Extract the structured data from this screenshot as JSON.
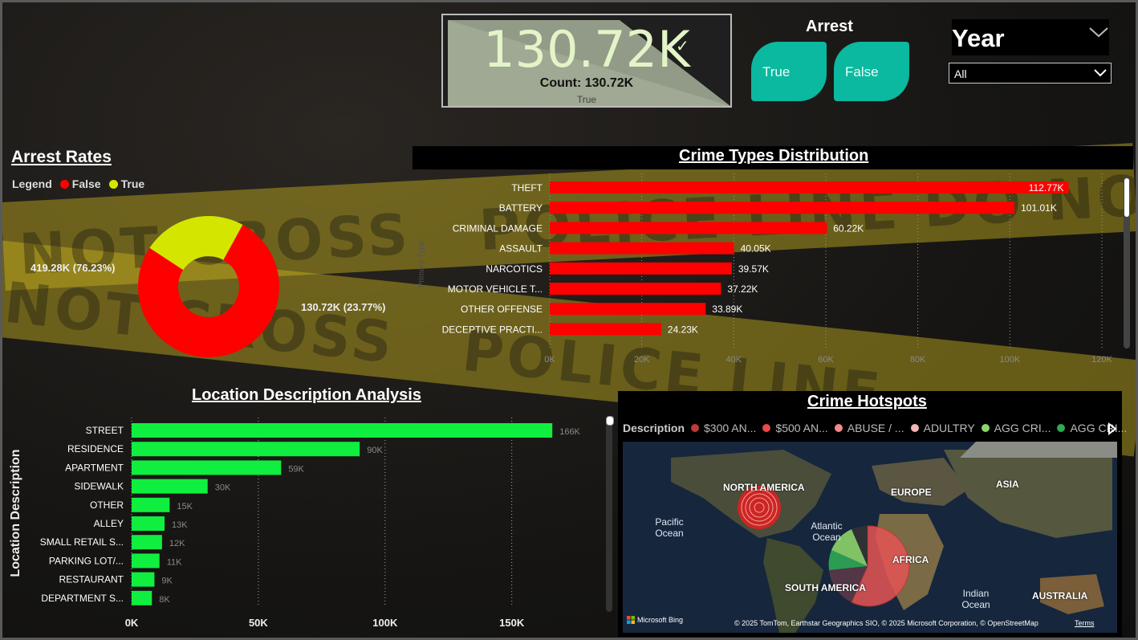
{
  "kpi": {
    "value": "130.72K",
    "tooltip": "Count: 130.72K",
    "sub": "True"
  },
  "arrest_slicer": {
    "title": "Arrest",
    "options": [
      "True",
      "False"
    ]
  },
  "year_slicer": {
    "title": "Year",
    "selected": "All"
  },
  "colors": {
    "false": "#ff0000",
    "true": "#d4e600",
    "crime_bar": "#ff0000",
    "location_bar": "#10ee40",
    "slicer": "#0bb8a0"
  },
  "arrest_rates": {
    "title": "Arrest Rates",
    "legend_title": "Legend",
    "false_label": "419.28K (76.23%)",
    "true_label": "130.72K (23.77%)"
  },
  "crime_types": {
    "title": "Crime Types Distribution",
    "yaxis_title": "Primary Type"
  },
  "location": {
    "title": "Location Description Analysis",
    "yaxis_title": "Location Description"
  },
  "hotspots": {
    "title": "Crime Hotspots",
    "legend_title": "Description",
    "legend_items": [
      {
        "label": "$300 AN...",
        "color": "#c0393b"
      },
      {
        "label": "$500 AN...",
        "color": "#e84a4a"
      },
      {
        "label": "ABUSE / ...",
        "color": "#f08a8a"
      },
      {
        "label": "ADULTRY",
        "color": "#f3b5b5"
      },
      {
        "label": "AGG CRI...",
        "color": "#8ed46a"
      },
      {
        "label": "AGG CRI...",
        "color": "#2faa55"
      }
    ],
    "map_labels": {
      "north_america": "NORTH AMERICA",
      "europe": "EUROPE",
      "asia": "ASIA",
      "africa": "AFRICA",
      "south_america": "SOUTH AMERICA",
      "australia": "AUSTRALIA",
      "pacific": "Pacific Ocean",
      "atlantic": "Atlantic Ocean",
      "indian": "Indian Ocean"
    },
    "bing": "Microsoft Bing",
    "credit": "© 2025 TomTom, Earthstar Geographics SIO, © 2025 Microsoft Corporation, © OpenStreetMap",
    "terms": "Terms"
  },
  "chart_data": [
    {
      "type": "pie",
      "title": "Arrest Rates",
      "categories": [
        "False",
        "True"
      ],
      "values": [
        419280,
        130720
      ],
      "labels": [
        "419.28K (76.23%)",
        "130.72K (23.77%)"
      ],
      "donut": true,
      "legend": "top-left"
    },
    {
      "type": "bar",
      "orientation": "horizontal",
      "title": "Crime Types Distribution",
      "ylabel": "Primary Type",
      "categories": [
        "THEFT",
        "BATTERY",
        "CRIMINAL DAMAGE",
        "ASSAULT",
        "NARCOTICS",
        "MOTOR VEHICLE T...",
        "OTHER OFFENSE",
        "DECEPTIVE PRACTI..."
      ],
      "values": [
        112770,
        101010,
        60220,
        40050,
        39570,
        37220,
        33890,
        24230
      ],
      "data_labels": [
        "112.77K",
        "101.01K",
        "60.22K",
        "40.05K",
        "39.57K",
        "37.22K",
        "33.89K",
        "24.23K"
      ],
      "xlim": [
        0,
        120000
      ],
      "xticks": [
        "0K",
        "20K",
        "40K",
        "60K",
        "80K",
        "100K",
        "120K"
      ],
      "grid": true
    },
    {
      "type": "bar",
      "orientation": "horizontal",
      "title": "Location Description Analysis",
      "ylabel": "Location Description",
      "categories": [
        "STREET",
        "RESIDENCE",
        "APARTMENT",
        "SIDEWALK",
        "OTHER",
        "ALLEY",
        "SMALL RETAIL S...",
        "PARKING LOT/...",
        "RESTAURANT",
        "DEPARTMENT S..."
      ],
      "values": [
        166000,
        90000,
        59000,
        30000,
        15000,
        13000,
        12000,
        11000,
        9000,
        8000
      ],
      "data_labels": [
        "166K",
        "90K",
        "59K",
        "30K",
        "15K",
        "13K",
        "12K",
        "11K",
        "9K",
        "8K"
      ],
      "xlim": [
        0,
        190000
      ],
      "xticks": [
        "0K",
        "50K",
        "100K",
        "150K"
      ],
      "grid": true
    }
  ]
}
